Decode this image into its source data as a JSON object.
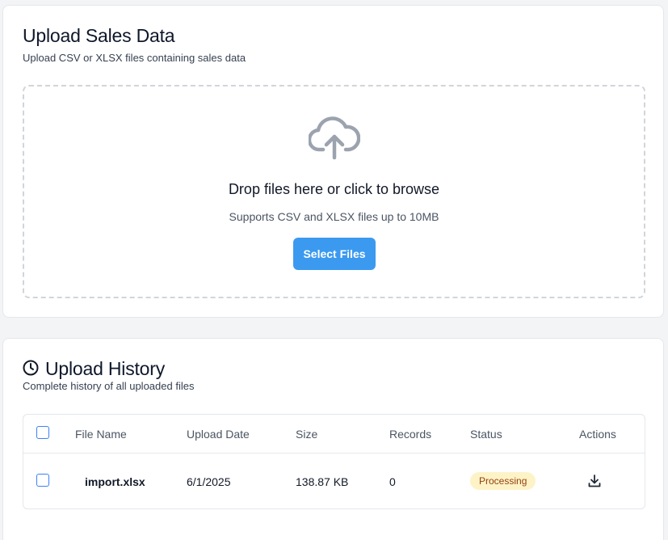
{
  "upload": {
    "title": "Upload Sales Data",
    "subtitle": "Upload CSV or XLSX files containing sales data",
    "dropzone": {
      "title": "Drop files here or click to browse",
      "hint": "Supports CSV and XLSX files up to 10MB",
      "button_label": "Select Files",
      "icon": "cloud-upload-icon"
    }
  },
  "history": {
    "title": "Upload History",
    "subtitle": "Complete history of all uploaded files",
    "icon": "clock-icon",
    "columns": [
      "File Name",
      "Upload Date",
      "Size",
      "Records",
      "Status",
      "Actions"
    ],
    "rows": [
      {
        "file_name": "import.xlsx",
        "upload_date": "6/1/2025",
        "size": "138.87 KB",
        "records": "0",
        "status": "Processing",
        "action_icon": "download-icon"
      }
    ]
  },
  "colors": {
    "accent": "#3b9af0",
    "status_processing_bg": "#fef3c7",
    "status_processing_text": "#92400e"
  }
}
